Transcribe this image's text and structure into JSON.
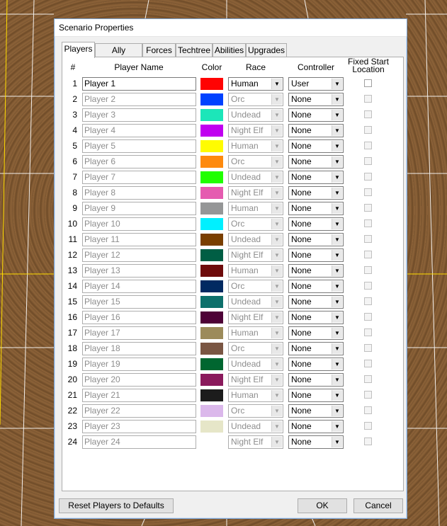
{
  "dialog": {
    "title": "Scenario Properties"
  },
  "tabs": [
    {
      "label": "Players",
      "active": true
    },
    {
      "label": "Ally Priorities",
      "active": false
    },
    {
      "label": "Forces",
      "active": false
    },
    {
      "label": "Techtree",
      "active": false
    },
    {
      "label": "Abilities",
      "active": false
    },
    {
      "label": "Upgrades",
      "active": false
    }
  ],
  "columns": {
    "num": "#",
    "name": "Player Name",
    "color": "Color",
    "race": "Race",
    "controller": "Controller",
    "fixed_line1": "Fixed Start",
    "fixed_line2": "Location"
  },
  "players": [
    {
      "num": "1",
      "name": "Player 1",
      "color": "#ff0303",
      "race": "Human",
      "controller": "User",
      "enabled": true
    },
    {
      "num": "2",
      "name": "Player 2",
      "color": "#0042ff",
      "race": "Orc",
      "controller": "None",
      "enabled": false
    },
    {
      "num": "3",
      "name": "Player 3",
      "color": "#1ce6b9",
      "race": "Undead",
      "controller": "None",
      "enabled": false
    },
    {
      "num": "4",
      "name": "Player 4",
      "color": "#c000f0",
      "race": "Night Elf",
      "controller": "None",
      "enabled": false
    },
    {
      "num": "5",
      "name": "Player 5",
      "color": "#fffc01",
      "race": "Human",
      "controller": "None",
      "enabled": false
    },
    {
      "num": "6",
      "name": "Player 6",
      "color": "#fe8a0e",
      "race": "Orc",
      "controller": "None",
      "enabled": false
    },
    {
      "num": "7",
      "name": "Player 7",
      "color": "#20ff00",
      "race": "Undead",
      "controller": "None",
      "enabled": false
    },
    {
      "num": "8",
      "name": "Player 8",
      "color": "#e55bb0",
      "race": "Night Elf",
      "controller": "None",
      "enabled": false
    },
    {
      "num": "9",
      "name": "Player 9",
      "color": "#959697",
      "race": "Human",
      "controller": "None",
      "enabled": false
    },
    {
      "num": "10",
      "name": "Player 10",
      "color": "#00f0ff",
      "race": "Orc",
      "controller": "None",
      "enabled": false
    },
    {
      "num": "11",
      "name": "Player 11",
      "color": "#7a3f00",
      "race": "Undead",
      "controller": "None",
      "enabled": false
    },
    {
      "num": "12",
      "name": "Player 12",
      "color": "#005e44",
      "race": "Night Elf",
      "controller": "None",
      "enabled": false
    },
    {
      "num": "13",
      "name": "Player 13",
      "color": "#6e0b0b",
      "race": "Human",
      "controller": "None",
      "enabled": false
    },
    {
      "num": "14",
      "name": "Player 14",
      "color": "#012a61",
      "race": "Orc",
      "controller": "None",
      "enabled": false
    },
    {
      "num": "15",
      "name": "Player 15",
      "color": "#0d706b",
      "race": "Undead",
      "controller": "None",
      "enabled": false
    },
    {
      "num": "16",
      "name": "Player 16",
      "color": "#4e0237",
      "race": "Night Elf",
      "controller": "None",
      "enabled": false
    },
    {
      "num": "17",
      "name": "Player 17",
      "color": "#9c8b5b",
      "race": "Human",
      "controller": "None",
      "enabled": false
    },
    {
      "num": "18",
      "name": "Player 18",
      "color": "#7a5643",
      "race": "Orc",
      "controller": "None",
      "enabled": false
    },
    {
      "num": "19",
      "name": "Player 19",
      "color": "#006630",
      "race": "Undead",
      "controller": "None",
      "enabled": false
    },
    {
      "num": "20",
      "name": "Player 20",
      "color": "#8a1a5c",
      "race": "Night Elf",
      "controller": "None",
      "enabled": false
    },
    {
      "num": "21",
      "name": "Player 21",
      "color": "#1c1c1c",
      "race": "Human",
      "controller": "None",
      "enabled": false
    },
    {
      "num": "22",
      "name": "Player 22",
      "color": "#dbb8eb",
      "race": "Orc",
      "controller": "None",
      "enabled": false
    },
    {
      "num": "23",
      "name": "Player 23",
      "color": "#e6e6c8",
      "race": "Undead",
      "controller": "None",
      "enabled": false
    },
    {
      "num": "24",
      "name": "Player 24",
      "color": "#ffffff",
      "race": "Night Elf",
      "controller": "None",
      "enabled": false
    }
  ],
  "buttons": {
    "reset": "Reset Players to Defaults",
    "ok": "OK",
    "cancel": "Cancel"
  }
}
